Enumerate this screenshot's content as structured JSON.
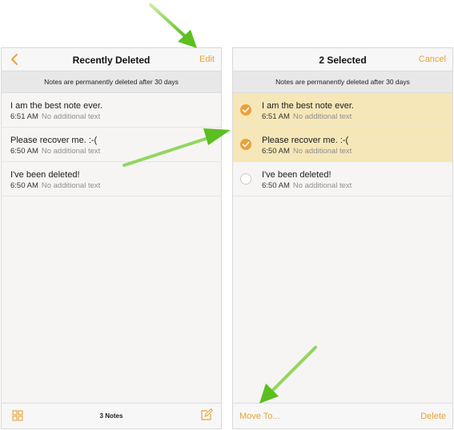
{
  "colors": {
    "accent": "#e8a23a",
    "selected_row": "#f6e7b8",
    "arrow_green": "#7ccf3a"
  },
  "left_screen": {
    "back_icon": "chevron-left-icon",
    "title": "Recently Deleted",
    "edit_label": "Edit",
    "banner": "Notes are permanently deleted after 30 days",
    "notes": [
      {
        "title": "I am the best note ever.",
        "time": "6:51 AM",
        "subtitle": "No additional text"
      },
      {
        "title": "Please recover me. :-(",
        "time": "6:50 AM",
        "subtitle": "No additional text"
      },
      {
        "title": "I've been deleted!",
        "time": "6:50 AM",
        "subtitle": "No additional text"
      }
    ],
    "toolbar": {
      "grid_icon": "grid-icon",
      "count": "3 Notes",
      "compose_icon": "compose-icon"
    }
  },
  "right_screen": {
    "title": "2 Selected",
    "cancel_label": "Cancel",
    "banner": "Notes are permanently deleted after 30 days",
    "notes": [
      {
        "title": "I am the best note ever.",
        "time": "6:51 AM",
        "subtitle": "No additional text",
        "selected": true
      },
      {
        "title": "Please recover me. :-(",
        "time": "6:50 AM",
        "subtitle": "No additional text",
        "selected": true
      },
      {
        "title": "I've been deleted!",
        "time": "6:50 AM",
        "subtitle": "No additional text",
        "selected": false
      }
    ],
    "toolbar": {
      "move_label": "Move To...",
      "delete_label": "Delete"
    }
  }
}
